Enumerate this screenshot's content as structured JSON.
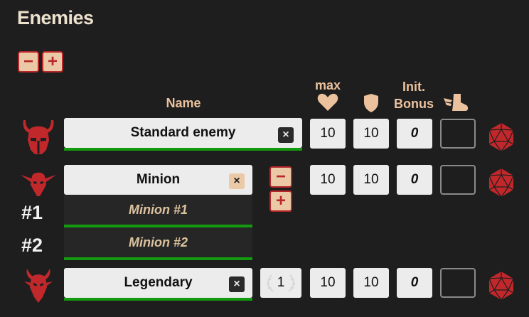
{
  "section": {
    "title": "Enemies"
  },
  "controls": {
    "remove_glyph": "−",
    "add_glyph": "+"
  },
  "headers": {
    "name": "Name",
    "max": "max",
    "init_line1": "Init.",
    "init_line2": "Bonus"
  },
  "icons": {
    "heart": "heart-icon",
    "shield": "shield-icon",
    "boot": "winged-boot-icon",
    "d20": "d20-icon",
    "standard": "horned-helmet-icon",
    "minion": "goblin-head-icon",
    "legendary": "dragon-head-icon"
  },
  "colors": {
    "accent": "#b8272b",
    "tan": "#ebc29d",
    "bar": "#139a0e",
    "bg": "#1e1e1e"
  },
  "enemies": {
    "standard": {
      "name": "Standard enemy",
      "close": "×",
      "max_hp": "10",
      "ac": "10",
      "init": "0",
      "initiative_roll": ""
    },
    "minion": {
      "name": "Minion",
      "close": "×",
      "max_hp": "10",
      "ac": "10",
      "init": "0",
      "initiative_roll": "",
      "minus": "−",
      "plus": "+",
      "instances": [
        {
          "label": "#1",
          "name": "Minion #1"
        },
        {
          "label": "#2",
          "name": "Minion #2"
        }
      ]
    },
    "legendary": {
      "name": "Legendary",
      "close": "×",
      "legendary_actions": "1",
      "max_hp": "10",
      "ac": "10",
      "init": "0",
      "initiative_roll": ""
    }
  }
}
